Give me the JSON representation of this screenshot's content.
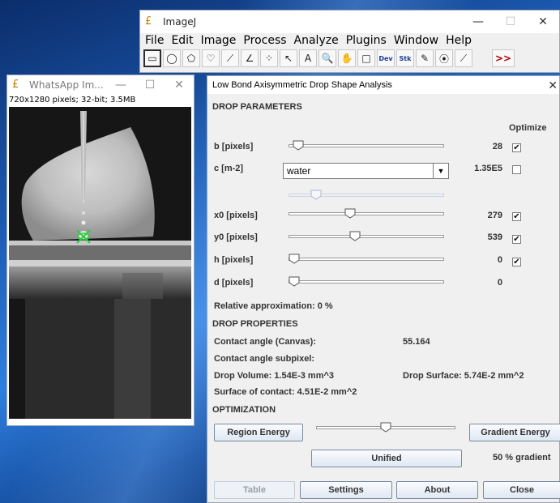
{
  "imagej": {
    "title": "ImageJ",
    "menu": [
      "File",
      "Edit",
      "Image",
      "Process",
      "Analyze",
      "Plugins",
      "Window",
      "Help"
    ],
    "tools": [
      {
        "icon": "rectangle-tool-icon",
        "glyph": "▭"
      },
      {
        "icon": "oval-tool-icon",
        "glyph": "◯"
      },
      {
        "icon": "polygon-tool-icon",
        "glyph": "⬠"
      },
      {
        "icon": "freehand-tool-icon",
        "glyph": "♡"
      },
      {
        "icon": "line-tool-icon",
        "glyph": "⟋"
      },
      {
        "icon": "angle-tool-icon",
        "glyph": "∠"
      },
      {
        "icon": "point-tool-icon",
        "glyph": "⁘"
      },
      {
        "icon": "wand-tool-icon",
        "glyph": "↖"
      },
      {
        "icon": "text-tool-icon",
        "glyph": "A"
      },
      {
        "icon": "magnifier-tool-icon",
        "glyph": "🔍"
      },
      {
        "icon": "hand-tool-icon",
        "glyph": "✋"
      },
      {
        "icon": "dropper-tool-icon",
        "glyph": "□"
      },
      {
        "icon": "dev-tool-icon",
        "glyph": "Dev"
      },
      {
        "icon": "stk-tool-icon",
        "glyph": "Stk"
      },
      {
        "icon": "pencil-tool-icon",
        "glyph": "✎"
      },
      {
        "icon": "brush-tool-icon",
        "glyph": "⦿"
      },
      {
        "icon": "flood-tool-icon",
        "glyph": "⟋"
      },
      {
        "icon": "more-tools-icon",
        "glyph": ">>"
      }
    ]
  },
  "image_window": {
    "title": "WhatsApp Im...",
    "info": "720x1280 pixels; 32-bit; 3.5MB"
  },
  "dialog": {
    "title": "Low Bond Axisymmetric Drop Shape Analysis",
    "sections": {
      "params": "DROP PARAMETERS",
      "props": "DROP PROPERTIES",
      "opt": "OPTIMIZATION"
    },
    "optimize_header": "Optimize",
    "params": [
      {
        "label": "b [pixels]",
        "value": "28",
        "optimize": true,
        "slider": 0.03
      },
      {
        "label": "c [m-2]",
        "value": "1.35E5",
        "optimize": false,
        "combo": "water",
        "slider": 0.15
      },
      {
        "label": "x0 [pixels]",
        "value": "279",
        "optimize": true,
        "slider": 0.39
      },
      {
        "label": "y0 [pixels]",
        "value": "539",
        "optimize": true,
        "slider": 0.42
      },
      {
        "label": "h [pixels]",
        "value": "0",
        "optimize": true,
        "slider": 0.0
      },
      {
        "label": "d [pixels]",
        "value": "0",
        "slider": 0.0
      }
    ],
    "relative_approx": "Relative approximation: 0 %",
    "properties": {
      "contact_angle_canvas_label": "Contact angle (Canvas):",
      "contact_angle_canvas_value": "55.164",
      "contact_angle_subpixel_label": "Contact angle subpixel:",
      "drop_volume": "Drop Volume: 1.54E-3 mm^3",
      "drop_surface": "Drop Surface: 5.74E-2 mm^2",
      "surface_contact": "Surface of contact: 4.51E-2 mm^2"
    },
    "optimization": {
      "region_button": "Region Energy",
      "gradient_button": "Gradient Energy",
      "unified_button": "Unified",
      "blend_text": "50 % gradient",
      "blend": 0.5
    },
    "buttons": {
      "table": "Table",
      "settings": "Settings",
      "about": "About",
      "close": "Close"
    }
  }
}
